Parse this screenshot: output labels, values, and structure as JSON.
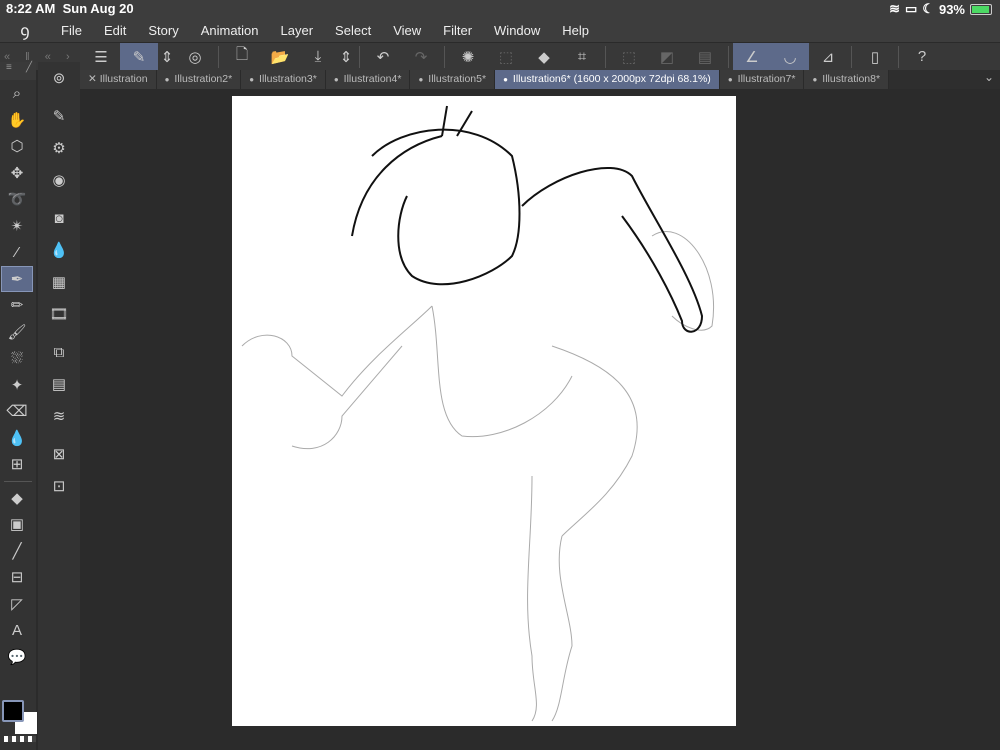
{
  "status_bar": {
    "time": "8:22 AM",
    "date": "Sun Aug 20",
    "battery": "93%"
  },
  "menu": {
    "items": [
      "File",
      "Edit",
      "Story",
      "Animation",
      "Layer",
      "Select",
      "View",
      "Filter",
      "Window",
      "Help"
    ]
  },
  "tabs": [
    {
      "label": "Illustration",
      "active": false,
      "closable": true
    },
    {
      "label": "Illustration2*",
      "active": false
    },
    {
      "label": "Illustration3*",
      "active": false
    },
    {
      "label": "Illustration4*",
      "active": false
    },
    {
      "label": "Illustration5*",
      "active": false
    },
    {
      "label": "Illustration6* (1600 x 2000px 72dpi 68.1%)",
      "active": true
    },
    {
      "label": "Illustration7*",
      "active": false
    },
    {
      "label": "Illustration8*",
      "active": false
    }
  ],
  "colors": {
    "accent": "#5d6a8a",
    "main_color": "#000000",
    "sub_color": "#ffffff"
  }
}
